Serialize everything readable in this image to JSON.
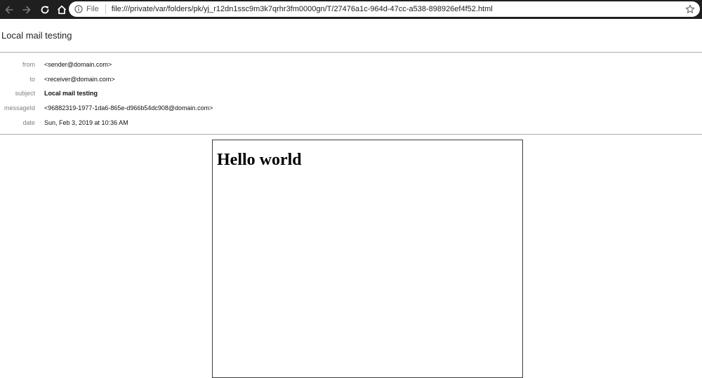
{
  "browser": {
    "scheme_label": "File",
    "url": "file:///private/var/folders/pk/yj_r12dn1ssc9m3k7qrhr3fm0000gn/T/27476a1c-964d-47cc-a538-898926ef4f52.html",
    "icons": {
      "back": "arrow-left-icon",
      "forward": "arrow-right-icon",
      "reload": "reload-icon",
      "home": "home-icon",
      "info": "info-icon",
      "bookmark": "star-icon"
    },
    "colors": {
      "toolbar_bg": "#1f1f20",
      "omnibox_bg": "#ffffff"
    }
  },
  "email": {
    "title": "Local mail testing",
    "headers": [
      {
        "label": "from",
        "value": "<sender@domain.com>"
      },
      {
        "label": "to",
        "value": "<receiver@domain.com>"
      },
      {
        "label": "subject",
        "value": "Local mail testing"
      },
      {
        "label": "messageId",
        "value": "<96882319-1977-1da6-865e-d966b54dc908@domain.com>"
      },
      {
        "label": "date",
        "value": "Sun, Feb 3, 2019 at 10:36 AM"
      }
    ],
    "body_heading": "Hello world"
  }
}
